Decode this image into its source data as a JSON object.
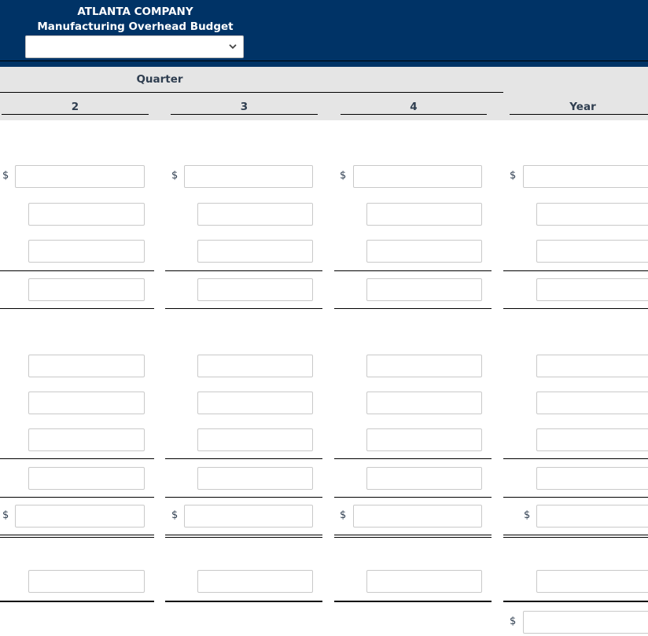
{
  "header": {
    "company": "ATLANTA COMPANY",
    "report_title": "Manufacturing Overhead Budget",
    "period_select": {
      "selected": "",
      "icon": "chevron-down-icon"
    }
  },
  "columns": {
    "group_label": "Quarter",
    "headers": [
      "2",
      "3",
      "4",
      "Year"
    ]
  },
  "currency_symbol": "$",
  "rows": [
    {
      "id": "row-1",
      "dollar": true,
      "values": [
        "",
        "",
        "",
        ""
      ]
    },
    {
      "id": "row-2",
      "dollar": false,
      "values": [
        "",
        "",
        "",
        ""
      ]
    },
    {
      "id": "row-3",
      "dollar": false,
      "values": [
        "",
        "",
        "",
        ""
      ]
    },
    {
      "id": "row-4-subtotal",
      "dollar": false,
      "values": [
        "",
        "",
        "",
        ""
      ]
    },
    {
      "id": "row-5",
      "dollar": false,
      "values": [
        "",
        "",
        "",
        ""
      ]
    },
    {
      "id": "row-6",
      "dollar": false,
      "values": [
        "",
        "",
        "",
        ""
      ]
    },
    {
      "id": "row-7",
      "dollar": false,
      "values": [
        "",
        "",
        "",
        ""
      ]
    },
    {
      "id": "row-8",
      "dollar": false,
      "values": [
        "",
        "",
        "",
        ""
      ]
    },
    {
      "id": "row-9-total",
      "dollar": true,
      "values": [
        "",
        "",
        "",
        ""
      ]
    },
    {
      "id": "row-10",
      "dollar": false,
      "values": [
        "",
        "",
        "",
        ""
      ]
    },
    {
      "id": "row-11-year-total",
      "dollar": true,
      "values": [
        ""
      ]
    }
  ],
  "colors": {
    "header_bg": "#003366",
    "column_header_bg": "#e5e5e5",
    "header_text": "#2f3e50"
  }
}
